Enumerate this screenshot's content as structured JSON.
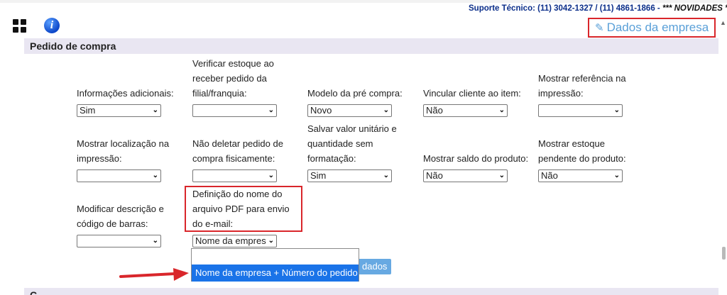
{
  "support": {
    "text": "Suporte Técnico: (11) 3042-1327 / (11) 4861-1866 - ",
    "news": "*** NOVIDADES ***"
  },
  "header": {
    "dados_empresa": "Dados da empresa"
  },
  "section": {
    "title": "Pedido de compra"
  },
  "fields": [
    {
      "label": "Informações adicionais:",
      "value": "Sim"
    },
    {
      "label": "Verificar estoque ao receber pedido da filial/franquia:",
      "value": ""
    },
    {
      "label": "Modelo da pré compra:",
      "value": "Novo"
    },
    {
      "label": "Vincular cliente ao item:",
      "value": "Não"
    },
    {
      "label": "Mostrar referência na impressão:",
      "value": ""
    },
    {
      "label": "Mostrar localização na impressão:",
      "value": ""
    },
    {
      "label": "Não deletar pedido de compra fisicamente:",
      "value": ""
    },
    {
      "label": "Salvar valor unitário e quantidade sem formatação:",
      "value": "Sim"
    },
    {
      "label": "Mostrar saldo do produto:",
      "value": "Não"
    },
    {
      "label": "Mostrar estoque pendente do produto:",
      "value": "Não"
    },
    {
      "label": "Modificar descrição e código de barras:",
      "value": ""
    },
    {
      "label": "Definição do nome do arquivo PDF para envio do e-mail:",
      "value": "Nome da empres"
    }
  ],
  "dropdown": {
    "option": "Nome da empresa + Número do pedido"
  },
  "save_button": {
    "label": "dados"
  },
  "section2": {
    "title": "C..."
  },
  "colors": {
    "highlight": "#d9262b",
    "accent": "#1a73e8",
    "link": "#5aa0d8"
  }
}
